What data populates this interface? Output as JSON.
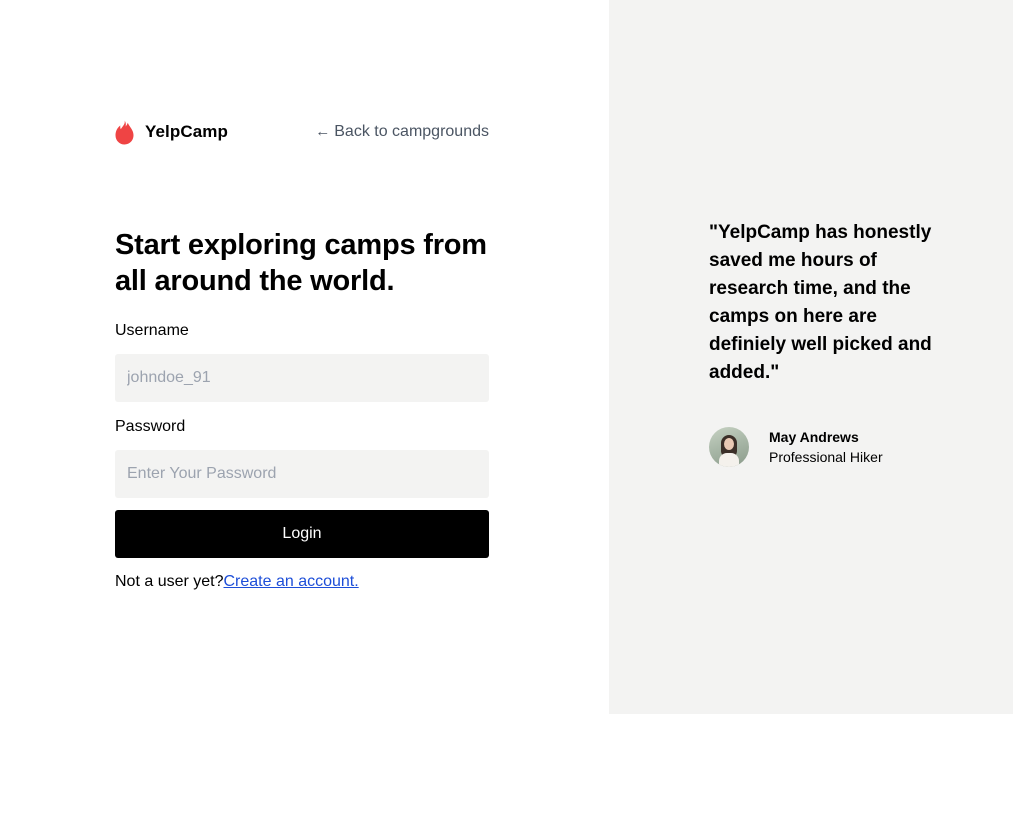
{
  "brand": {
    "name": "YelpCamp",
    "accent_color": "#ef4444",
    "icon": "flame-icon"
  },
  "nav": {
    "back_arrow": "←",
    "back_label": "Back to campgrounds"
  },
  "hero": {
    "headline": "Start exploring camps from all around the world."
  },
  "form": {
    "username_label": "Username",
    "username_placeholder": "johndoe_91",
    "username_value": "",
    "password_label": "Password",
    "password_placeholder": "Enter Your Password",
    "password_value": "",
    "login_label": "Login",
    "signup_prompt": "Not a user yet?",
    "signup_link": "Create an account."
  },
  "testimonial": {
    "quote": "\"YelpCamp has honestly saved me hours of research time, and the camps on here are definiely well picked and added.\"",
    "author_name": "May Andrews",
    "author_role": "Professional Hiker"
  },
  "colors": {
    "panel_bg": "#f3f3f2",
    "input_bg": "#f3f3f2",
    "button_bg": "#000000",
    "link": "#1d4ed8",
    "muted_text": "#4b5563"
  }
}
